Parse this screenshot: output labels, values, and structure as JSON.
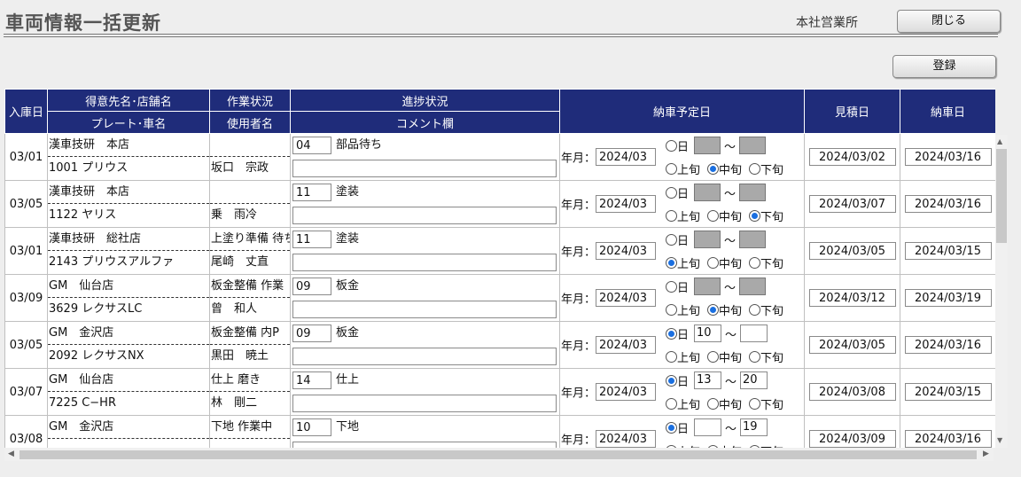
{
  "page": {
    "title": "車両情報一括更新",
    "office": "本社営業所",
    "close_label": "閉じる",
    "register_label": "登録"
  },
  "headers": {
    "entry_date": "入庫日",
    "customer": "得意先名･店舗名",
    "plate": "プレート･車名",
    "work_status": "作業状況",
    "user": "使用者名",
    "progress": "進捗状況",
    "comment": "コメント欄",
    "delivery_plan": "納車予定日",
    "estimate_date": "見積日",
    "delivery_date": "納車日"
  },
  "labels": {
    "year_month": "年月：",
    "day": "日",
    "tilde": "～",
    "early": "上旬",
    "mid": "中旬",
    "late": "下旬"
  },
  "rows": [
    {
      "entry": "03/01",
      "customer": "漢車技研　本店",
      "plate": "1001 プリウス",
      "work": "",
      "user": "坂口　宗政",
      "code": "04",
      "status": "部品待ち",
      "comment": "",
      "ym": "2024/03",
      "sel": "mid",
      "day_from": "",
      "day_to": "",
      "est": "2024/03/02",
      "deliv": "2024/03/16"
    },
    {
      "entry": "03/05",
      "customer": "漢車技研　本店",
      "plate": "1122 ヤリス",
      "work": "",
      "user": "乗　雨冷",
      "code": "11",
      "status": "塗装",
      "comment": "",
      "ym": "2024/03",
      "sel": "late",
      "day_from": "",
      "day_to": "",
      "est": "2024/03/07",
      "deliv": "2024/03/16"
    },
    {
      "entry": "03/01",
      "customer": "漢車技研　総社店",
      "plate": "2143 プリウスアルファ",
      "work": "上塗り準備 待ち",
      "user": "尾崎　丈直",
      "code": "11",
      "status": "塗装",
      "comment": "",
      "ym": "2024/03",
      "sel": "early",
      "day_from": "",
      "day_to": "",
      "est": "2024/03/05",
      "deliv": "2024/03/15"
    },
    {
      "entry": "03/09",
      "customer": "GM　仙台店",
      "plate": "3629 レクサスLC",
      "work": "板金整備 作業",
      "user": "曾　和人",
      "code": "09",
      "status": "板金",
      "comment": "",
      "ym": "2024/03",
      "sel": "mid",
      "day_from": "",
      "day_to": "",
      "est": "2024/03/12",
      "deliv": "2024/03/19"
    },
    {
      "entry": "03/05",
      "customer": "GM　金沢店",
      "plate": "2092 レクサスNX",
      "work": "板金整備 内P",
      "user": "黒田　暁土",
      "code": "09",
      "status": "板金",
      "comment": "",
      "ym": "2024/03",
      "sel": "day",
      "day_from": "10",
      "day_to": "",
      "est": "2024/03/05",
      "deliv": "2024/03/16"
    },
    {
      "entry": "03/07",
      "customer": "GM　仙台店",
      "plate": "7225 C−HR",
      "work": "仕上 磨き",
      "user": "林　剛二",
      "code": "14",
      "status": "仕上",
      "comment": "",
      "ym": "2024/03",
      "sel": "day",
      "day_from": "13",
      "day_to": "20",
      "est": "2024/03/08",
      "deliv": "2024/03/15"
    },
    {
      "entry": "03/08",
      "customer": "GM　金沢店",
      "plate": "",
      "work": "下地 作業中",
      "user": "",
      "code": "10",
      "status": "下地",
      "comment": "",
      "ym": "2024/03",
      "sel": "day",
      "day_from": "",
      "day_to": "19",
      "est": "2024/03/09",
      "deliv": "2024/03/16"
    }
  ]
}
